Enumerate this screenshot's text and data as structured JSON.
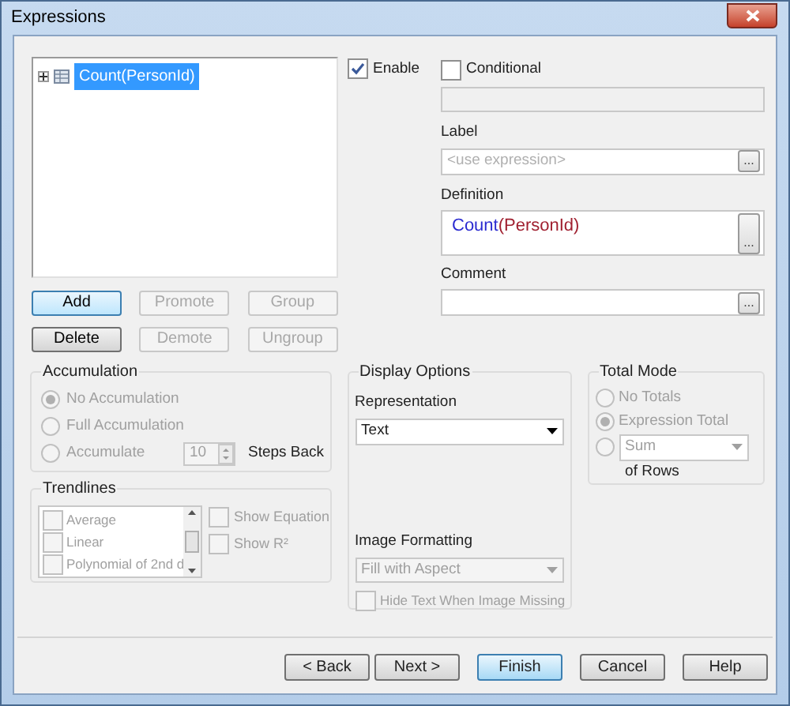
{
  "window": {
    "title": "Expressions"
  },
  "tree": [
    {
      "label": "Count(PersonId)",
      "selected": true,
      "expanded": false
    }
  ],
  "edit_buttons": [
    {
      "label": "Add",
      "disabled": false,
      "focused": true
    },
    {
      "label": "Promote",
      "disabled": true,
      "focused": false
    },
    {
      "label": "Group",
      "disabled": true,
      "focused": false
    },
    {
      "label": "Delete",
      "disabled": false,
      "focused": false
    },
    {
      "label": "Demote",
      "disabled": true,
      "focused": false
    },
    {
      "label": "Ungroup",
      "disabled": true,
      "focused": false
    }
  ],
  "enable": {
    "label": "Enable",
    "checked": true
  },
  "conditional": {
    "label": "Conditional",
    "checked": false
  },
  "label_field": {
    "label": "Label",
    "placeholder": "<use expression>",
    "button": "..."
  },
  "definition": {
    "label": "Definition",
    "tokens": [
      {
        "text": "Count",
        "kind": "function"
      },
      {
        "text": "(PersonId)",
        "kind": "field"
      }
    ],
    "button": "..."
  },
  "comment": {
    "label": "Comment",
    "button": "..."
  },
  "accumulation": {
    "title": "Accumulation",
    "options": [
      {
        "label": "No Accumulation",
        "selected": true
      },
      {
        "label": "Full Accumulation",
        "selected": false
      },
      {
        "label": "Accumulate",
        "selected": false
      }
    ],
    "steps": "10",
    "steps_label": "Steps Back"
  },
  "trendlines": {
    "title": "Trendlines",
    "items": [
      {
        "label": "Average",
        "checked": false
      },
      {
        "label": "Linear",
        "checked": false
      },
      {
        "label": "Polynomial of 2nd d",
        "checked": false
      }
    ],
    "show_equation": {
      "label": "Show Equation",
      "checked": false
    },
    "show_r2": {
      "label": "Show R²",
      "checked": false
    }
  },
  "display_options": {
    "title": "Display Options",
    "representation": {
      "label": "Representation",
      "value": "Text"
    },
    "image_formatting": {
      "label": "Image Formatting",
      "value": "Fill with Aspect"
    },
    "hide_text": {
      "label": "Hide Text When Image Missing",
      "checked": false
    }
  },
  "total_mode": {
    "title": "Total Mode",
    "options": [
      {
        "label": "No Totals",
        "selected": false
      },
      {
        "label": "Expression Total",
        "selected": true
      }
    ],
    "aggregate_selected": false,
    "aggregate": "Sum",
    "suffix": "of Rows"
  },
  "footer_buttons": [
    {
      "label": "< Back",
      "focused": false
    },
    {
      "label": "Next >",
      "focused": false
    },
    {
      "label": "Finish",
      "focused": true
    },
    {
      "label": "Cancel",
      "focused": false
    },
    {
      "label": "Help",
      "focused": false
    }
  ]
}
